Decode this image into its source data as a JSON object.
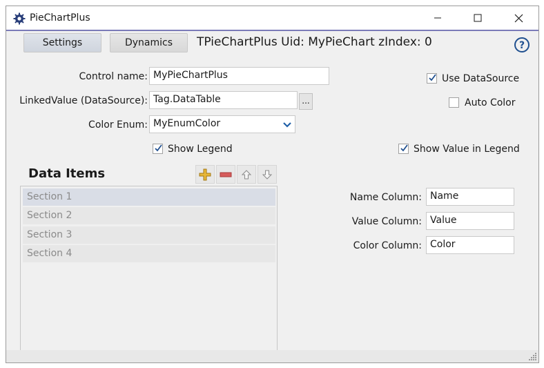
{
  "window": {
    "title": "PieChartPlus",
    "app_icon": "gear-icon",
    "controls": {
      "minimize": "minimize-icon",
      "maximize": "maximize-icon",
      "close": "close-icon"
    }
  },
  "tabs": [
    {
      "label": "Settings",
      "active": true
    },
    {
      "label": "Dynamics",
      "active": false
    }
  ],
  "header": {
    "info": "TPieChartPlus Uid: MyPieChart zIndex: 0",
    "help_icon": "help-icon"
  },
  "form": {
    "control_name": {
      "label": "Control name:",
      "value": "MyPieChartPlus"
    },
    "linked_value": {
      "label": "LinkedValue (DataSource):",
      "value": "Tag.DataTable",
      "browse_label": "..."
    },
    "color_enum": {
      "label": "Color Enum:",
      "value": "MyEnumColor"
    },
    "show_legend": {
      "label": "Show Legend",
      "checked": true
    },
    "use_datasource": {
      "label": "Use DataSource",
      "checked": true
    },
    "auto_color": {
      "label": "Auto Color",
      "checked": false
    },
    "show_value_in_legend": {
      "label": "Show Value in Legend",
      "checked": true
    }
  },
  "data_items": {
    "title": "Data Items",
    "toolbar": [
      "add-icon",
      "remove-icon",
      "move-up-icon",
      "move-down-icon"
    ],
    "items": [
      "Section 1",
      "Section 2",
      "Section 3",
      "Section 4"
    ],
    "selected_index": 0
  },
  "columns": {
    "name": {
      "label": "Name Column:",
      "value": "Name"
    },
    "value": {
      "label": "Value Column:",
      "value": "Value"
    },
    "color": {
      "label": "Color Column:",
      "value": "Color"
    }
  },
  "colors": {
    "accent": "#1f5fa8",
    "title_border": "#7a7ab8",
    "add": "#d9a21b",
    "remove": "#d65c5c"
  }
}
